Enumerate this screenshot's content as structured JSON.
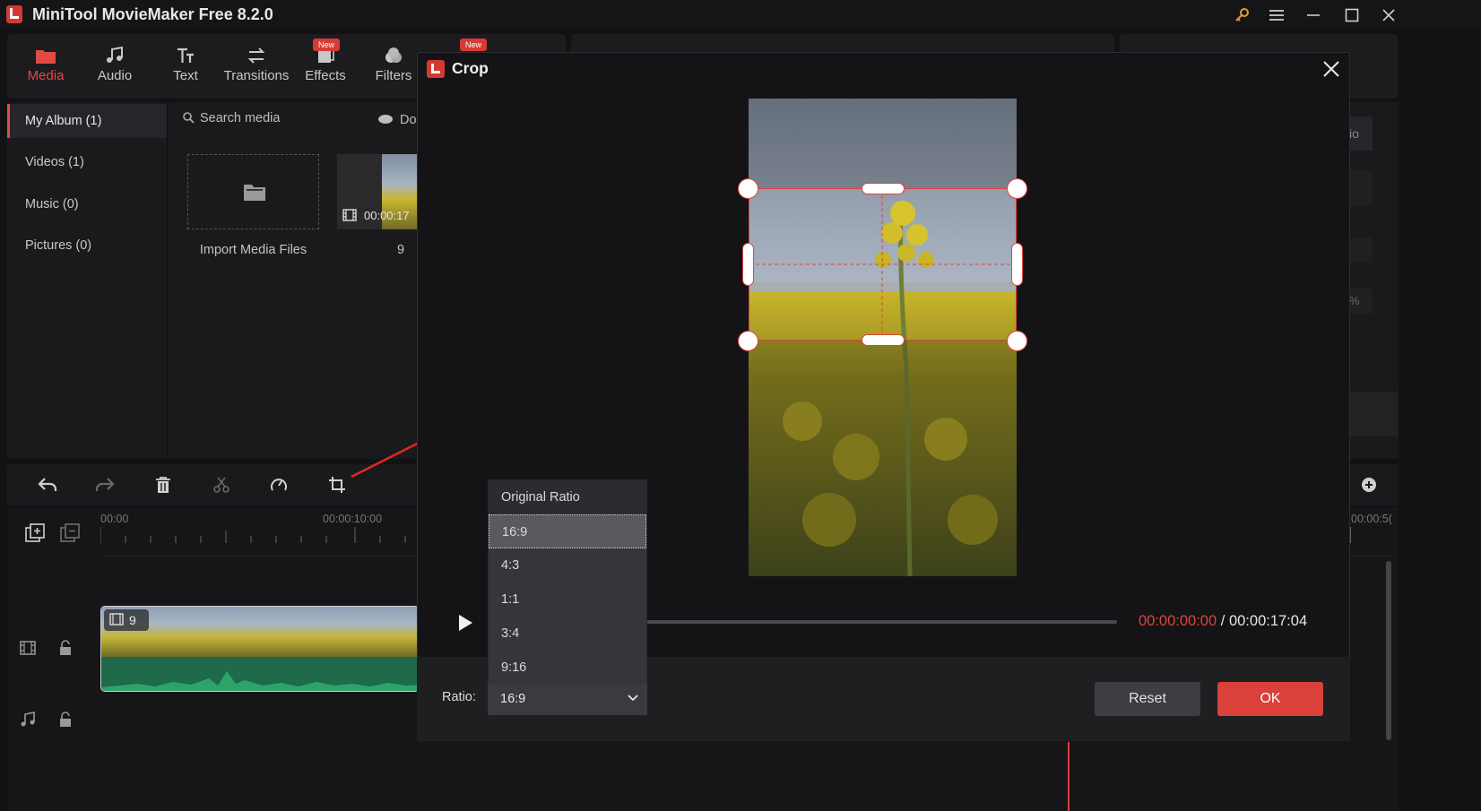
{
  "app": {
    "title": "MiniTool MovieMaker Free 8.2.0"
  },
  "nav": [
    {
      "label": "Media",
      "icon": "media-folder-icon",
      "active": true
    },
    {
      "label": "Audio",
      "icon": "music-note-icon"
    },
    {
      "label": "Text",
      "icon": "text-icon"
    },
    {
      "label": "Transitions",
      "icon": "transition-icon"
    },
    {
      "label": "Effects",
      "icon": "effects-icon",
      "badge": "New"
    },
    {
      "label": "Filters",
      "icon": "filters-icon"
    }
  ],
  "nav_extra_badge": "New",
  "album": [
    {
      "label": "My Album (1)",
      "active": true
    },
    {
      "label": "Videos (1)"
    },
    {
      "label": "Music (0)"
    },
    {
      "label": "Pictures (0)"
    }
  ],
  "search": {
    "placeholder": "Search media",
    "download_label": "Do"
  },
  "media": {
    "import_label": "Import Media Files",
    "clip_duration": "00:00:17",
    "clip_name": "9"
  },
  "right_panel": {
    "ratio_fragment": "io",
    "percent_fragment": "%"
  },
  "timeline": {
    "ruler": [
      "00:00",
      "00:00:10:00",
      "00:00:5("
    ],
    "clip_label": "9"
  },
  "dialog": {
    "title": "Crop",
    "time_current": "00:00:00:00",
    "time_separator": "/",
    "time_total": "00:00:17:04",
    "ratio_label": "Ratio:",
    "ratio_selected": "16:9",
    "ratio_options": [
      "Original Ratio",
      "16:9",
      "4:3",
      "1:1",
      "3:4",
      "9:16"
    ],
    "ratio_highlighted": "16:9",
    "reset_label": "Reset",
    "ok_label": "OK"
  },
  "colors": {
    "accent": "#d9413a",
    "timecode_current": "#e0433c",
    "audio_wave": "#1f7a52"
  }
}
